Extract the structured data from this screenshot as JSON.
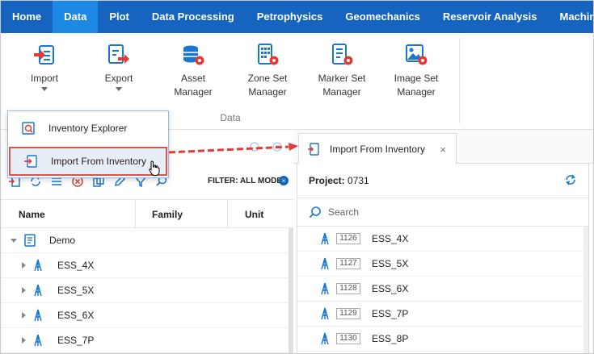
{
  "menubar": {
    "items": [
      {
        "label": "Home",
        "active": false
      },
      {
        "label": "Data",
        "active": true
      },
      {
        "label": "Plot",
        "active": false
      },
      {
        "label": "Data Processing",
        "active": false
      },
      {
        "label": "Petrophysics",
        "active": false
      },
      {
        "label": "Geomechanics",
        "active": false
      },
      {
        "label": "Reservoir Analysis",
        "active": false
      },
      {
        "label": "Machine Learning",
        "active": false
      }
    ]
  },
  "ribbon": {
    "import": {
      "label": "Import",
      "icon": "import-icon"
    },
    "export": {
      "label": "Export",
      "icon": "export-icon"
    },
    "asset_manager": {
      "line1": "Asset",
      "line2": "Manager",
      "icon": "database-gear-icon"
    },
    "zone_set_manager": {
      "line1": "Zone Set",
      "line2": "Manager",
      "icon": "zone-set-gear-icon"
    },
    "marker_set_manager": {
      "line1": "Marker Set",
      "line2": "Manager",
      "icon": "marker-set-gear-icon"
    },
    "image_set_manager": {
      "line1": "Image Set",
      "line2": "Manager",
      "icon": "image-set-gear-icon"
    },
    "group_label": "Data"
  },
  "dropdown": {
    "items": [
      {
        "label": "Inventory Explorer",
        "icon": "inventory-search-icon"
      },
      {
        "label": "Import From Inventory",
        "icon": "import-from-inventory-icon",
        "highlighted": true
      }
    ]
  },
  "left_panel": {
    "filter_label": "FILTER: ALL MODE",
    "filter_clear": "×",
    "columns": {
      "name": "Name",
      "family": "Family",
      "unit": "Unit"
    },
    "tree": [
      {
        "label": "Demo",
        "type": "project",
        "expanded": true
      },
      {
        "label": "ESS_4X",
        "type": "well"
      },
      {
        "label": "ESS_5X",
        "type": "well"
      },
      {
        "label": "ESS_6X",
        "type": "well"
      },
      {
        "label": "ESS_7P",
        "type": "well"
      }
    ]
  },
  "right_panel": {
    "tab_label": "Import From Inventory",
    "tab_close": "×",
    "project_label": "Project:",
    "project_value": "0731",
    "search_placeholder": "Search",
    "wells": [
      {
        "id": "1126",
        "name": "ESS_4X"
      },
      {
        "id": "1127",
        "name": "ESS_5X"
      },
      {
        "id": "1128",
        "name": "ESS_6X"
      },
      {
        "id": "1129",
        "name": "ESS_7P"
      },
      {
        "id": "1130",
        "name": "ESS_8P"
      }
    ]
  },
  "colors": {
    "menubar": "#1565c0",
    "menu_active": "#1e88e5",
    "icon_blue": "#1976d2",
    "icon_red": "#e53935",
    "highlight_border": "#d9534f"
  }
}
